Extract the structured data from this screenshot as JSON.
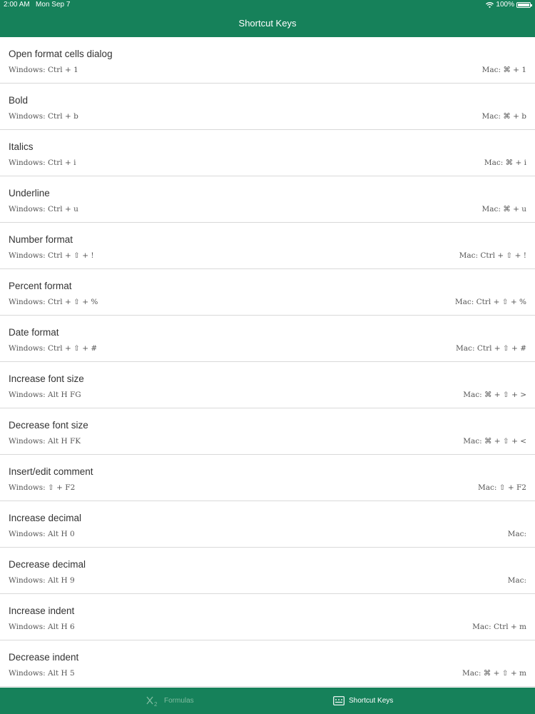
{
  "status": {
    "time": "2:00 AM",
    "date": "Mon Sep 7",
    "battery": "100%"
  },
  "header": {
    "title": "Shortcut Keys"
  },
  "shortcuts": [
    {
      "title": "Open format cells dialog",
      "windows": "Windows: Ctrl + 1",
      "mac": "Mac: ⌘ + 1"
    },
    {
      "title": "Bold",
      "windows": "Windows: Ctrl + b",
      "mac": "Mac: ⌘ + b"
    },
    {
      "title": "Italics",
      "windows": "Windows: Ctrl + i",
      "mac": "Mac: ⌘ + i"
    },
    {
      "title": "Underline",
      "windows": "Windows: Ctrl + u",
      "mac": "Mac: ⌘ + u"
    },
    {
      "title": "Number format",
      "windows": "Windows: Ctrl + ⇧ + !",
      "mac": "Mac: Ctrl + ⇧ + !"
    },
    {
      "title": "Percent format",
      "windows": "Windows: Ctrl + ⇧ + %",
      "mac": "Mac: Ctrl + ⇧ + %"
    },
    {
      "title": "Date format",
      "windows": "Windows: Ctrl + ⇧ + #",
      "mac": "Mac: Ctrl + ⇧ + #"
    },
    {
      "title": "Increase font size",
      "windows": "Windows: Alt H FG",
      "mac": "Mac: ⌘ + ⇧ + >"
    },
    {
      "title": "Decrease font size",
      "windows": "Windows: Alt H FK",
      "mac": "Mac: ⌘ + ⇧ + <"
    },
    {
      "title": "Insert/edit comment",
      "windows": "Windows: ⇧ + F2",
      "mac": "Mac: ⇧ + F2"
    },
    {
      "title": "Increase decimal",
      "windows": "Windows: Alt H 0",
      "mac": "Mac:"
    },
    {
      "title": "Decrease decimal",
      "windows": "Windows: Alt H 9",
      "mac": "Mac:"
    },
    {
      "title": "Increase indent",
      "windows": "Windows: Alt H 6",
      "mac": "Mac: Ctrl + m"
    },
    {
      "title": "Decrease indent",
      "windows": "Windows: Alt H 5",
      "mac": "Mac: ⌘ + ⇧ + m"
    }
  ],
  "tabs": {
    "formulas": {
      "label": "Formulas",
      "icon": "formula-icon",
      "selected": false
    },
    "shortcuts": {
      "label": "Shortcut Keys",
      "icon": "keyboard-icon",
      "selected": true
    }
  },
  "colors": {
    "brand": "#16815a",
    "tab_inactive": "#7fbb9f",
    "tab_active": "#ffffff"
  }
}
